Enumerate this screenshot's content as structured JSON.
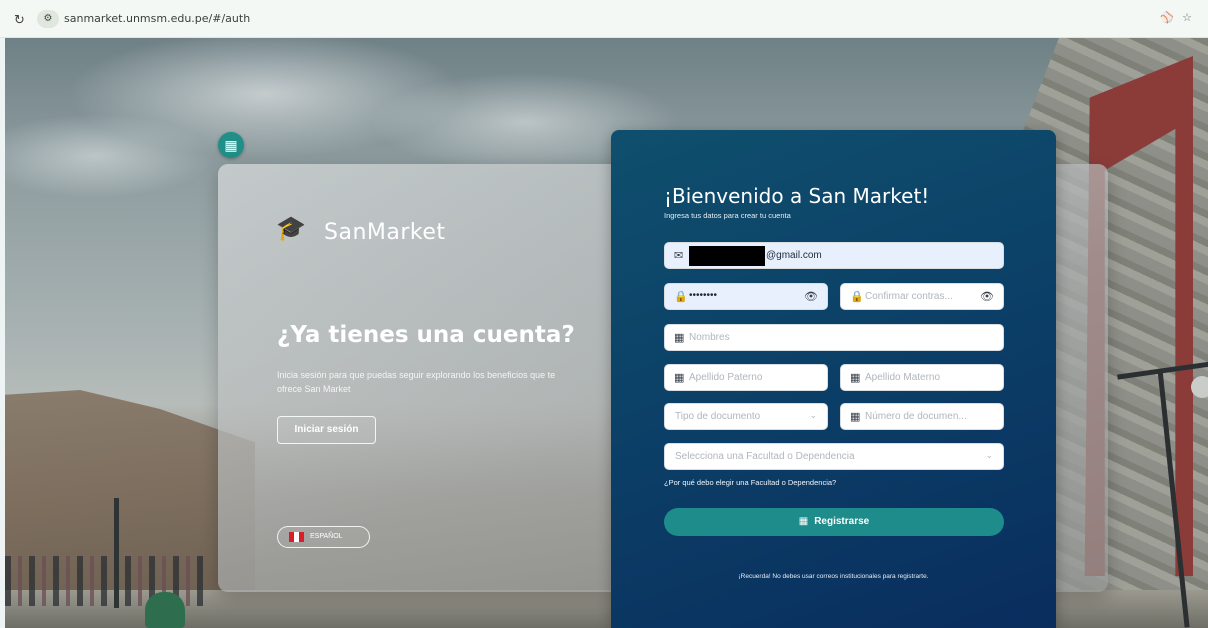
{
  "browser": {
    "reload_icon": "reload-icon",
    "site_info_icon": "site-info-icon",
    "url": "sanmarket.unmsm.edu.pe/#/auth",
    "right_icons": [
      "key-icon",
      "star-icon"
    ]
  },
  "app": {
    "badge_icon": "storefront-icon",
    "logo": {
      "mark_icon": "graduation-cart-icon",
      "text": "SanMarket"
    }
  },
  "left": {
    "title": "¿Ya tienes una cuenta?",
    "description": "Inicia sesión para que puedas seguir explorando los beneficios que te ofrece San Market",
    "login_button": "Iniciar sesión",
    "language": {
      "flag": "peru-flag-icon",
      "label": "ESPAÑOL"
    }
  },
  "form": {
    "title": "¡Bienvenido a San Market!",
    "subtitle": "Ingresa tus datos para crear tu cuenta",
    "email": {
      "icon": "mail-icon",
      "value_suffix": "@gmail.com",
      "redacted": true
    },
    "password": {
      "icon": "lock-icon",
      "value": "••••••••",
      "toggle_icon": "eye-icon"
    },
    "confirm_password": {
      "icon": "lock-icon",
      "placeholder": "Confirmar contras...",
      "toggle_icon": "eye-icon"
    },
    "nombres": {
      "icon": "id-card-icon",
      "placeholder": "Nombres"
    },
    "apellido_paterno": {
      "icon": "id-card-icon",
      "placeholder": "Apellido Paterno"
    },
    "apellido_materno": {
      "icon": "id-card-icon",
      "placeholder": "Apellido Materno"
    },
    "tipo_documento": {
      "placeholder": "Tipo de documento",
      "chevron": "chevron-down-icon"
    },
    "numero_documento": {
      "icon": "id-card-icon",
      "placeholder": "Número de documen..."
    },
    "facultad": {
      "placeholder": "Selecciona una Facultad o Dependencia",
      "chevron": "chevron-down-icon"
    },
    "why_link": "¿Por qué debo elegir una Facultad o Dependencia?",
    "register_button": {
      "icon": "register-icon",
      "label": "Registrarse"
    },
    "notice": "¡Recuerda! No debes usar correos institucionales para registrarte."
  },
  "colors": {
    "panel_top": "#0f4f6d",
    "panel_bottom": "#0a2d5e",
    "accent_teal": "#1e8c8a",
    "badge": "#1f8f88",
    "autofill_bg": "#e8f0fe"
  }
}
